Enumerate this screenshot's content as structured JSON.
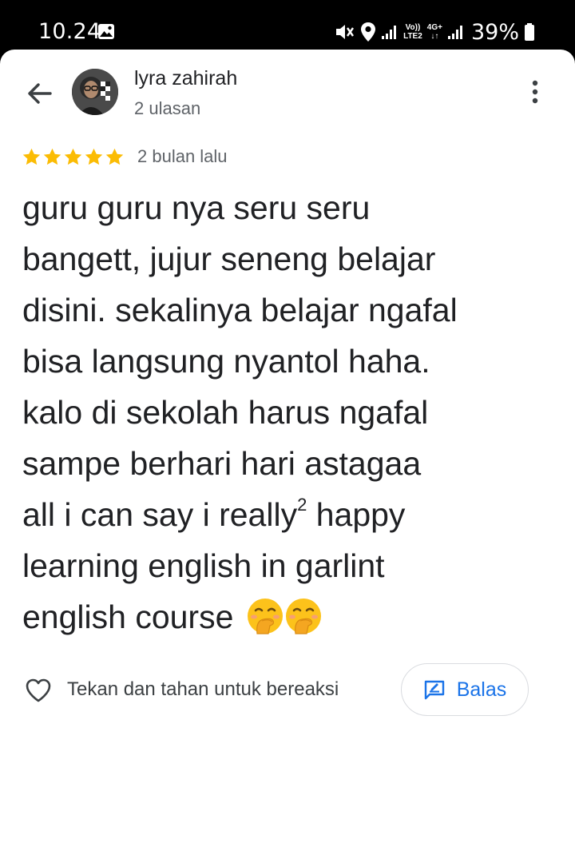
{
  "status_bar": {
    "time": "10.24",
    "battery": "39%",
    "volte_top": "Vo))",
    "volte_bottom": "LTE2",
    "net_top": "4G+",
    "net_bottom": "↓↑"
  },
  "reviewer": {
    "name": "lyra zahirah",
    "review_count": "2 ulasan"
  },
  "review": {
    "rating": 5,
    "date": "2 bulan lalu",
    "text_before_sup": "guru guru nya seru seru\nbangett, jujur seneng belajar\ndisini. sekalinya belajar ngafal\nbisa langsung nyantol haha.\nkalo di sekolah harus ngafal\nsampe berhari hari astagaa\nall i can say i really",
    "sup": "2",
    "text_after_sup": " happy\nlearning english in garlint\nenglish course"
  },
  "actions": {
    "react_hint": "Tekan dan tahan untuk bereaksi",
    "reply_label": "Balas"
  },
  "colors": {
    "star": "#fbbc04",
    "accent": "#1a73e8",
    "text": "#202124",
    "secondary_text": "#5f6368"
  },
  "icons": [
    "back-arrow-icon",
    "more-vert-icon",
    "star-icon",
    "heart-outline-icon",
    "reply-icon",
    "gallery-icon",
    "mute-icon",
    "location-icon",
    "signal-icon",
    "battery-icon",
    "emoji-hand-over-mouth-icon"
  ]
}
